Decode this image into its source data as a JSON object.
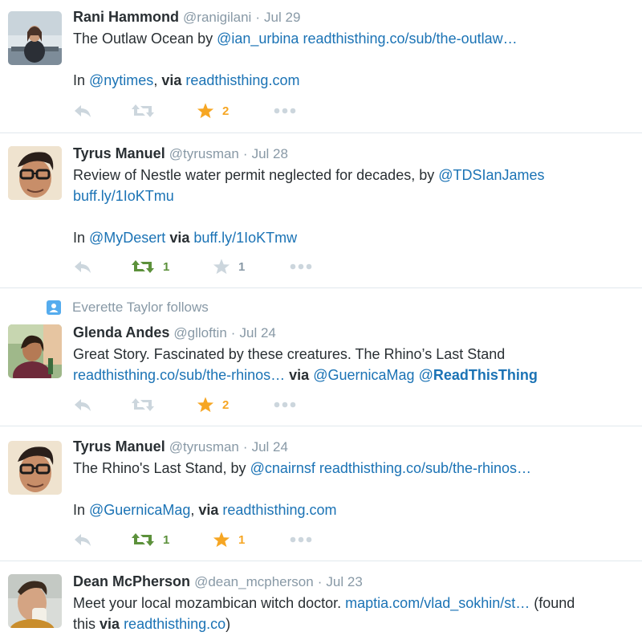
{
  "tweets": [
    {
      "name": "Rani Hammond",
      "handle": "@ranigilani",
      "time": "Jul 29",
      "line1": {
        "t1": "The Outlaw Ocean by ",
        "l1": "@ian_urbina",
        "t2": " ",
        "l2": "readthisthing.co/sub/the-outlaw…"
      },
      "line3": {
        "t1": "In ",
        "l1": "@nytimes",
        "t2": ", ",
        "b1": "via",
        "t3": " ",
        "l2": "readthisthing.com"
      },
      "retweets": "",
      "favorites": "2"
    },
    {
      "name": "Tyrus Manuel",
      "handle": "@tyrusman",
      "time": "Jul 28",
      "line1": {
        "t1": "Review of Nestle water permit neglected for decades, by ",
        "l1": "@TDSIanJames"
      },
      "line2": {
        "l1": "buff.ly/1IoKTmu"
      },
      "line4": {
        "t1": "In ",
        "l1": "@MyDesert",
        "t2": " ",
        "b1": "via",
        "t3": " ",
        "l2": "buff.ly/1IoKTmw"
      },
      "retweets": "1",
      "favorites": "1"
    },
    {
      "context": "Everette Taylor follows",
      "name": "Glenda Andes",
      "handle": "@glloftin",
      "time": "Jul 24",
      "line1": {
        "t1": "Great Story. Fascinated by these creatures. The Rhino’s Last Stand"
      },
      "line2": {
        "l1": "readthisthing.co/sub/the-rhinos…",
        "t1": " ",
        "b1": "via",
        "t2": " ",
        "l2": "@GuernicaMag",
        "t3": " ",
        "l3a": "@",
        "l3b": "ReadThisThing"
      },
      "retweets": "",
      "favorites": "2"
    },
    {
      "name": "Tyrus Manuel",
      "handle": "@tyrusman",
      "time": "Jul 24",
      "line1": {
        "t1": "The Rhino's Last Stand, by ",
        "l1": "@cnairnsf",
        "t2": " ",
        "l2": "readthisthing.co/sub/the-rhinos…"
      },
      "line3": {
        "t1": "In ",
        "l1": "@GuernicaMag",
        "t2": ", ",
        "b1": "via",
        "t3": " ",
        "l2": "readthisthing.com"
      },
      "retweets": "1",
      "favorites": "1"
    },
    {
      "name": "Dean McPherson",
      "handle": "@dean_mcpherson",
      "time": "Jul 23",
      "line1": {
        "t1": "Meet your local mozambican witch doctor. ",
        "l1": "maptia.com/vlad_sokhin/st…",
        "t2": " (found"
      },
      "line2": {
        "t1": "this ",
        "b1": "via",
        "t2": " ",
        "l1": "readthisthing.co",
        "t3": ")"
      }
    }
  ],
  "separator": "·",
  "colors": {
    "link": "#1b73b5",
    "favorite": "#f6a623",
    "retweet": "#5c913b",
    "muted": "#8899a6"
  }
}
